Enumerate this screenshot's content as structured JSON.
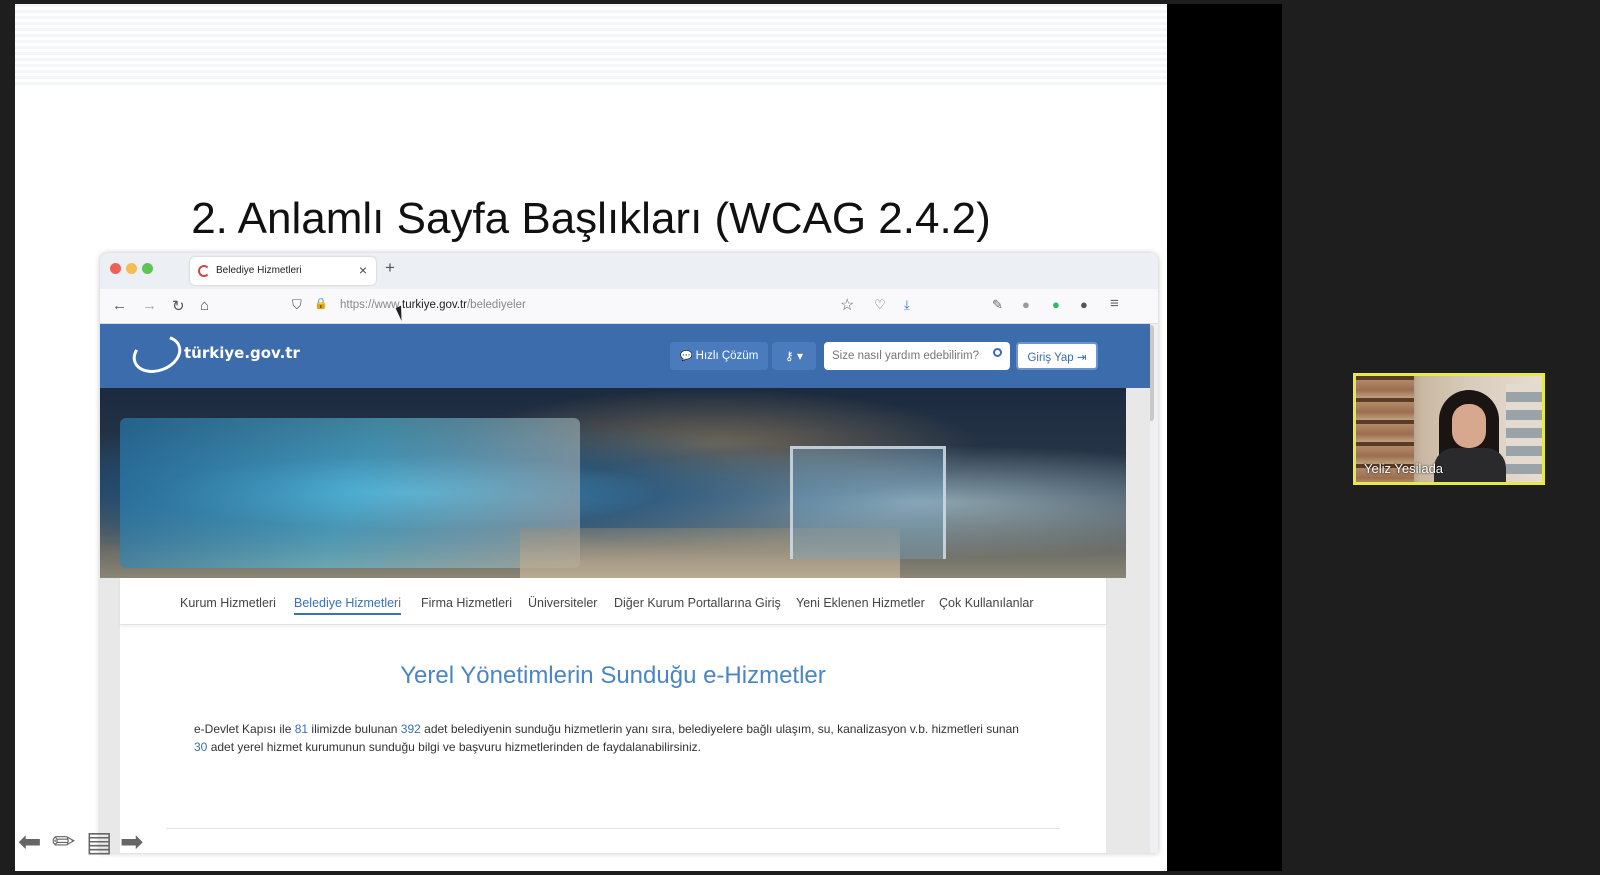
{
  "slide": {
    "title": "2. Anlamlı Sayfa Başlıkları (WCAG 2.4.2)"
  },
  "browser": {
    "tab_title": "Belediye Hizmetleri",
    "tab_close": "×",
    "new_tab": "+",
    "url_prefix": "https://www.",
    "url_host": "turkiye.gov.tr",
    "url_path": "/belediyeler",
    "traffic_colors": [
      "#ee5f57",
      "#f5bd4f",
      "#5fc454"
    ]
  },
  "site": {
    "logo_text": "türkiye.gov.tr",
    "quick_label": "Hızlı Çözüm",
    "search_placeholder": "Size nasıl yardım edebilirim?",
    "login_label": "Giriş Yap",
    "brand_color": "#3c6cab",
    "nav_tabs": [
      {
        "label": "Kurum Hizmetleri"
      },
      {
        "label": "Belediye Hizmetleri"
      },
      {
        "label": "Firma Hizmetleri"
      },
      {
        "label": "Üniversiteler"
      },
      {
        "label": "Diğer Kurum Portallarına Giriş"
      },
      {
        "label": "Yeni Eklenen Hizmetler"
      },
      {
        "label": "Çok Kullanılanlar"
      }
    ],
    "active_tab": "Belediye Hizmetleri",
    "section_title": "Yerel Yönetimlerin Sunduğu e-Hizmetler",
    "desc": {
      "p1": "e-Devlet Kapısı ile ",
      "n1": "81",
      "p2": " ilimizde bulunan ",
      "n2": "392",
      "p3": " adet belediyenin sunduğu hizmetlerin yanı sıra, belediyelere bağlı ulaşım, su, kanalizasyon v.b. hizmetleri sunan ",
      "n3": "30",
      "p4": " adet yerel hizmet kurumunun sunduğu bilgi ve başvuru hizmetlerinden de faydalanabilirsiniz."
    }
  },
  "participant": {
    "name": "Yeliz Yesilada",
    "highlight_color": "#e6e94a"
  },
  "icons": {
    "back": "←",
    "forward": "→",
    "reload": "↻",
    "home": "⌂",
    "shield": "⛉",
    "lock": "🔒",
    "star": "☆",
    "pocket": "♡",
    "download": "⤓",
    "pen": "✎",
    "ext1": "●",
    "ext2": "●",
    "ext3": "●",
    "menu": "≡",
    "chat": "💬",
    "key": "⚷ ▾",
    "login_arrow": "⇥",
    "slide_prev": "⬅",
    "slide_pen": "✏",
    "slide_menu": "▤",
    "slide_next": "➡"
  }
}
